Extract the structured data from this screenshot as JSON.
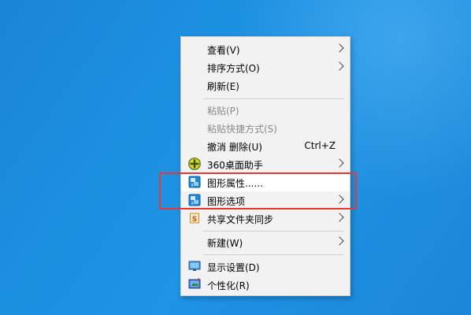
{
  "menu": {
    "view": "查看(V)",
    "sort": "排序方式(O)",
    "refresh": "刷新(E)",
    "paste": "粘贴(P)",
    "paste_shortcut": "粘贴快捷方式(S)",
    "undo_delete": "撤消 删除(U)",
    "undo_shortcut": "Ctrl+Z",
    "assistant_360": "360桌面助手",
    "graphics_properties": "图形属性......",
    "graphics_options": "图形选项",
    "sync": "共享文件夹同步",
    "new": "新建(W)",
    "display_settings": "显示设置(D)",
    "personalize": "个性化(R)"
  },
  "annotation_color": "#e53935"
}
